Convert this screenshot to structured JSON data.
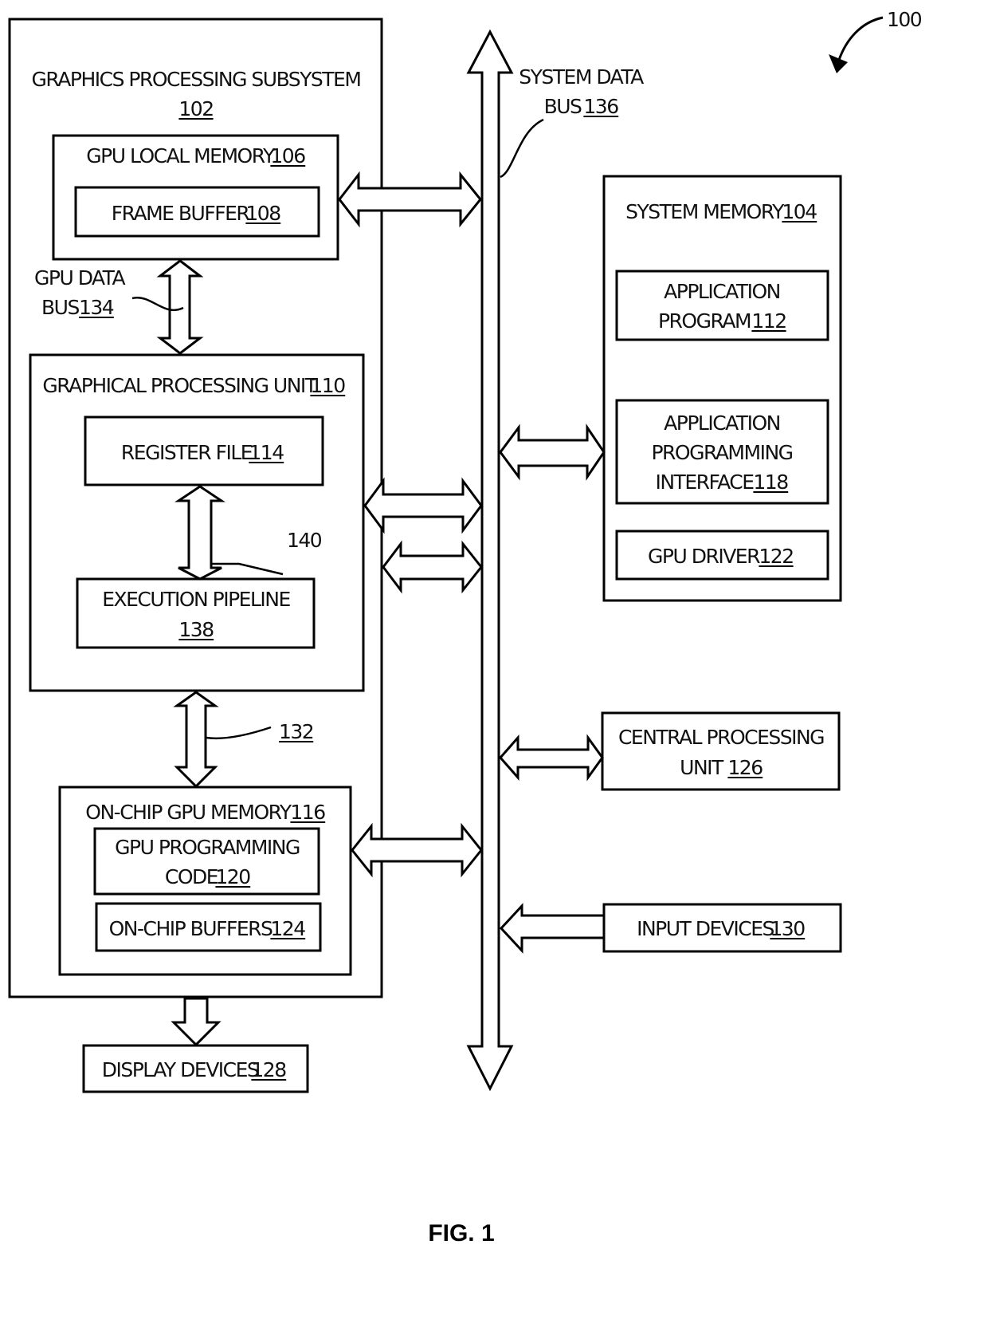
{
  "figure": {
    "number_label": "FIG. 1",
    "system_ref": "100"
  },
  "graphics_subsystem": {
    "title": "GRAPHICS PROCESSING SUBSYSTEM",
    "ref": "102",
    "gpu_local_memory": {
      "title": "GPU LOCAL MEMORY",
      "ref": "106",
      "frame_buffer": {
        "title": "FRAME BUFFER",
        "ref": "108"
      }
    },
    "gpu_data_bus": {
      "line1": "GPU DATA",
      "line2": "BUS",
      "ref": "134"
    },
    "gpu": {
      "title": "GRAPHICAL PROCESSING UNIT",
      "ref": "110",
      "register_file": {
        "title": "REGISTER FILE",
        "ref": "114"
      },
      "link_ref": "140",
      "execution_pipeline": {
        "line1": "EXECUTION PIPELINE",
        "ref": "138"
      }
    },
    "link_132": "132",
    "on_chip_memory": {
      "title": "ON-CHIP GPU MEMORY",
      "ref": "116",
      "programming_code": {
        "line1": "GPU PROGRAMMING",
        "line2": "CODE",
        "ref": "120"
      },
      "buffers": {
        "title": "ON-CHIP BUFFERS",
        "ref": "124"
      }
    }
  },
  "display_devices": {
    "title": "DISPLAY DEVICES",
    "ref": "128"
  },
  "system_bus": {
    "line1": "SYSTEM DATA",
    "line2": "BUS",
    "ref": "136"
  },
  "system_memory": {
    "title": "SYSTEM MEMORY",
    "ref": "104",
    "application_program": {
      "line1": "APPLICATION",
      "line2": "PROGRAM",
      "ref": "112"
    },
    "api": {
      "line1": "APPLICATION",
      "line2": "PROGRAMMING",
      "line3": "INTERFACE",
      "ref": "118"
    },
    "gpu_driver": {
      "title": "GPU DRIVER",
      "ref": "122"
    }
  },
  "cpu": {
    "line1": "CENTRAL PROCESSING",
    "line2": "UNIT",
    "ref": "126"
  },
  "input_devices": {
    "title": "INPUT DEVICES",
    "ref": "130"
  }
}
